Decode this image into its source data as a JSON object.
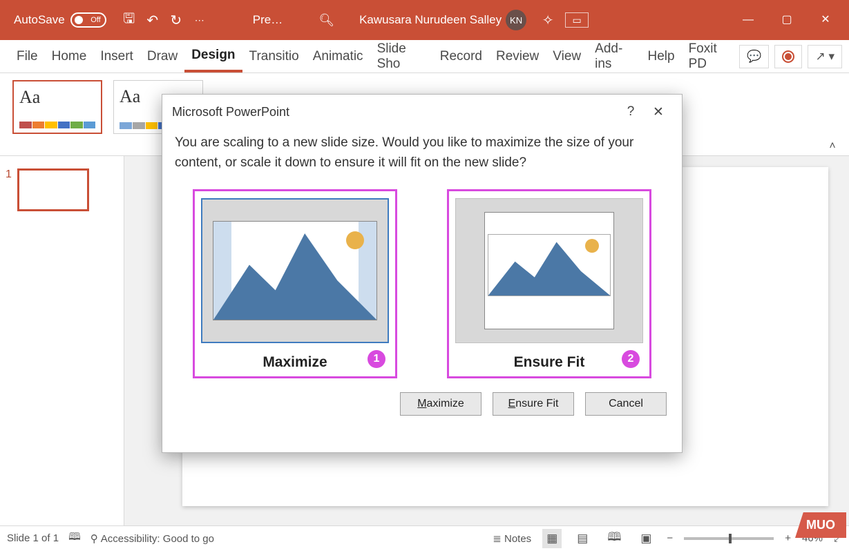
{
  "titlebar": {
    "autosave_label": "AutoSave",
    "autosave_state": "Off",
    "doc_name": "Pre…",
    "user_name": "Kawusara Nurudeen Salley",
    "user_initials": "KN"
  },
  "ribbon": {
    "tabs": [
      {
        "label": "File"
      },
      {
        "label": "Home"
      },
      {
        "label": "Insert"
      },
      {
        "label": "Draw"
      },
      {
        "label": "Design"
      },
      {
        "label": "Transitio"
      },
      {
        "label": "Animatic"
      },
      {
        "label": "Slide Sho"
      },
      {
        "label": "Record"
      },
      {
        "label": "Review"
      },
      {
        "label": "View"
      },
      {
        "label": "Add-ins"
      },
      {
        "label": "Help"
      },
      {
        "label": "Foxit PD"
      }
    ],
    "active_tab": "Design",
    "themes": [
      {
        "sample": "Aa",
        "colors": [
          "#c0504d",
          "#ed7d31",
          "#ffc000",
          "#4472c4",
          "#70ad47",
          "#5b9bd5"
        ],
        "selected": true
      },
      {
        "sample": "Aa",
        "colors": [
          "#7ca7d8",
          "#a6a6a6",
          "#ffc000",
          "#4472c4",
          "#ed7d31",
          "#70ad47"
        ],
        "selected": false
      }
    ]
  },
  "thumbnail": {
    "num": "1"
  },
  "dialog": {
    "title": "Microsoft PowerPoint",
    "message": "You are scaling to a new slide size.  Would you like to maximize the size of your content, or scale it down to ensure it will fit on the new slide?",
    "options": [
      {
        "label": "Maximize",
        "badge": "1"
      },
      {
        "label": "Ensure Fit",
        "badge": "2"
      }
    ],
    "buttons": {
      "maximize": "Maximize",
      "ensure_fit": "Ensure Fit",
      "cancel": "Cancel"
    }
  },
  "statusbar": {
    "slide_info": "Slide 1 of 1",
    "accessibility": "Accessibility: Good to go",
    "notes": "Notes",
    "zoom": "46%"
  },
  "watermark": "MUO"
}
